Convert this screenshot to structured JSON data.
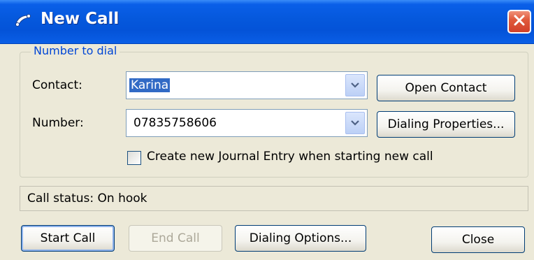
{
  "window": {
    "title": "New Call"
  },
  "group": {
    "legend": "Number to dial"
  },
  "contact": {
    "label": "Contact:",
    "value": "Karina"
  },
  "number": {
    "label": "Number:",
    "value": "07835758606"
  },
  "buttons": {
    "open_contact": "Open Contact",
    "dialing_properties": "Dialing Properties...",
    "start_call": "Start Call",
    "end_call": "End Call",
    "dialing_options": "Dialing Options...",
    "close": "Close"
  },
  "journal": {
    "label": "Create new Journal Entry when starting new call",
    "checked": false
  },
  "status": {
    "text": "Call status: On hook"
  },
  "icons": {
    "app": "phone-dial-icon",
    "close": "close-x-icon",
    "dropdown": "chevron-down-icon"
  },
  "colors": {
    "titlebar": "#0558dc",
    "legend": "#0046d5",
    "selection": "#316ac5",
    "close_button": "#d2402a"
  }
}
